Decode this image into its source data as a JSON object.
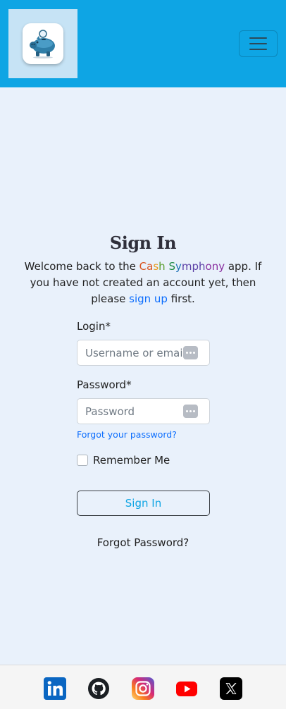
{
  "header": {
    "logo_icon": "piggy-bank-icon",
    "menu_icon": "hamburger-icon",
    "brand_color": "#0ea5e4"
  },
  "signin": {
    "title": "Sign In",
    "intro_before": "Welcome back to the ",
    "app_name_parts": [
      "Ca",
      "s",
      "h ",
      "S",
      "y",
      "mph",
      "ony"
    ],
    "intro_middle": " app. If you have not created an account yet, then please ",
    "signup_link": "sign up",
    "intro_after": " first."
  },
  "form": {
    "login_label": "Login*",
    "login_placeholder": "Username or email",
    "password_label": "Password*",
    "password_placeholder": "Password",
    "forgot_link": "Forgot your password?",
    "remember_label": "Remember Me",
    "remember_checked": false,
    "submit_label": "Sign In"
  },
  "forgot_bottom": "Forgot Password?",
  "footer": {
    "social_icons": [
      "linkedin-icon",
      "github-icon",
      "instagram-icon",
      "youtube-icon",
      "x-icon"
    ]
  }
}
